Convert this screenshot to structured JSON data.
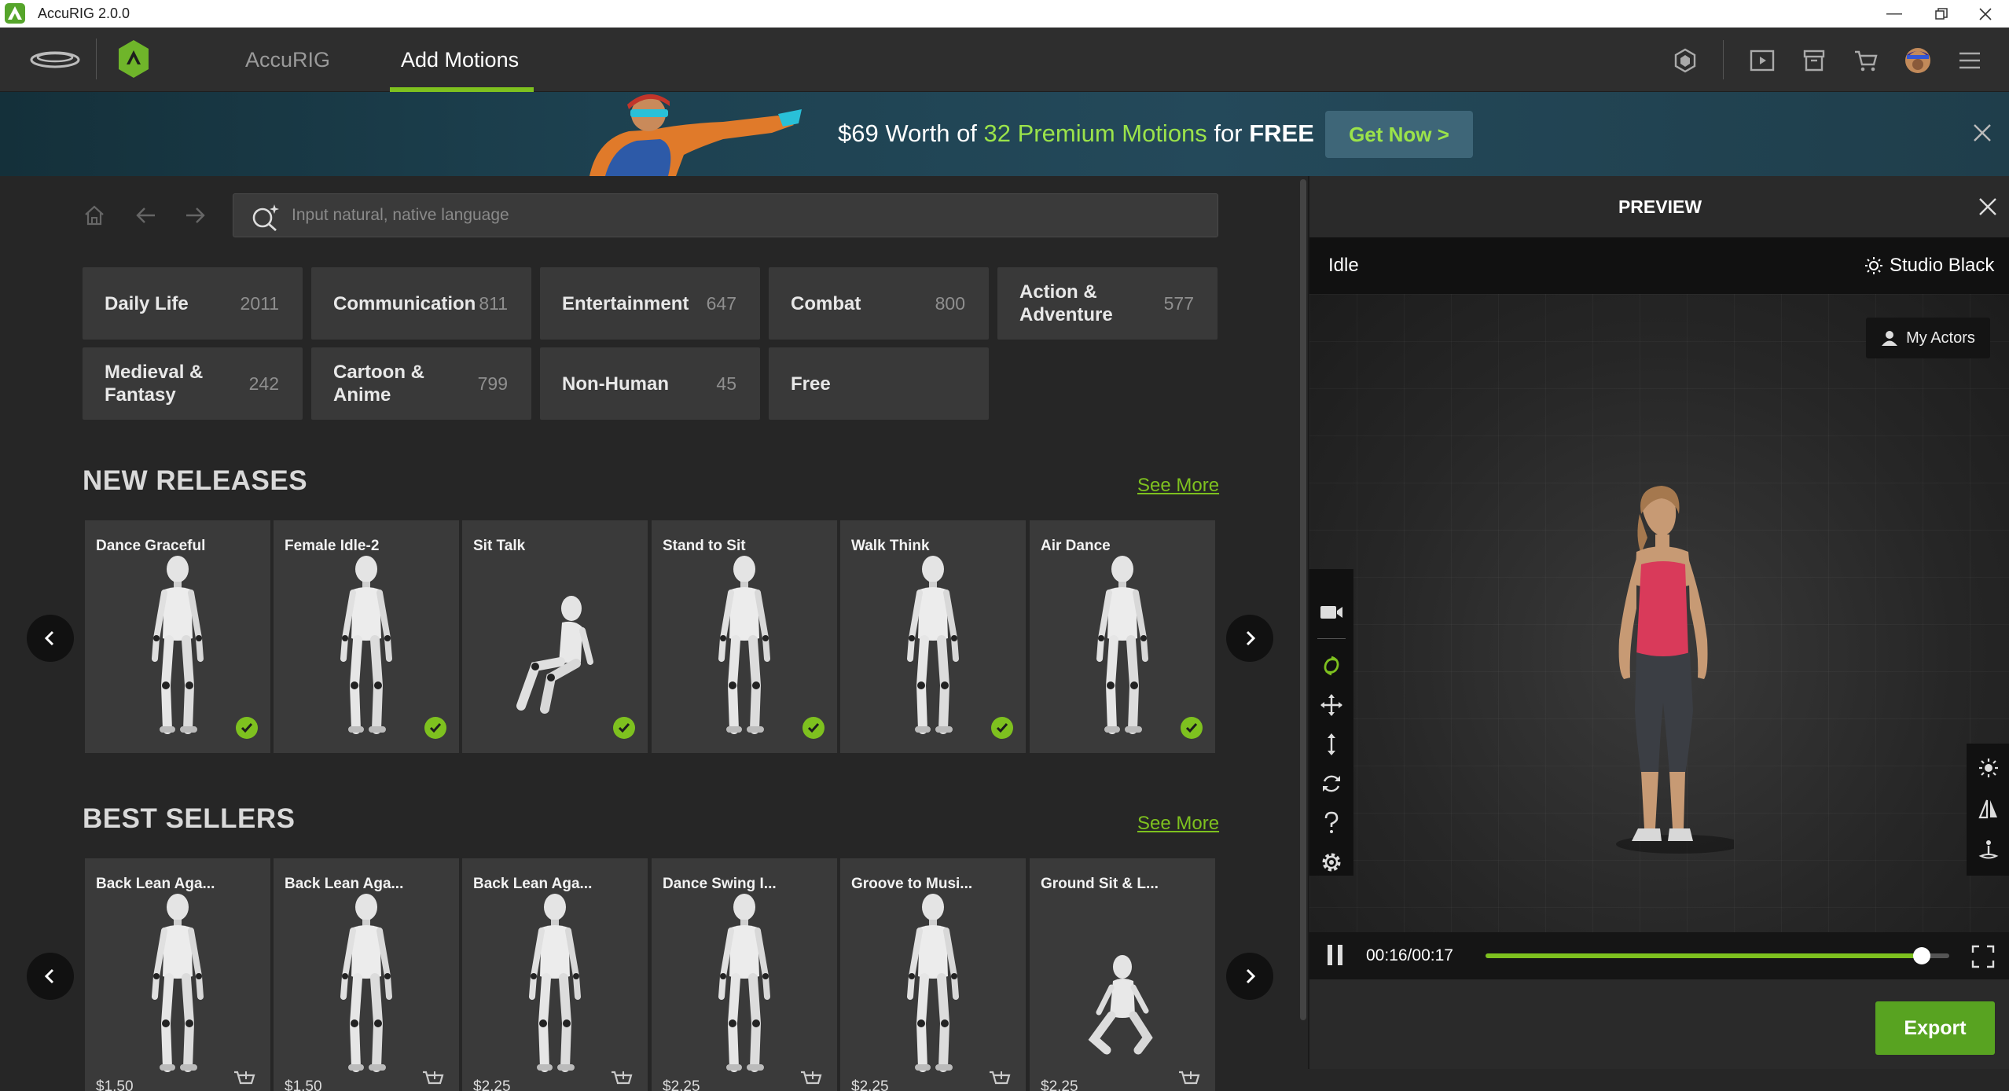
{
  "window": {
    "title": "AccuRIG 2.0.0"
  },
  "nav": {
    "tabs": [
      {
        "label": "AccuRIG",
        "active": false
      },
      {
        "label": "Add Motions",
        "active": true
      }
    ]
  },
  "banner": {
    "text_price": "$69 Worth of ",
    "text_highlight": "32 Premium Motions",
    "text_for": " for ",
    "text_free": "FREE",
    "cta": "Get Now >"
  },
  "search": {
    "placeholder": "Input natural, native language",
    "value": ""
  },
  "categories": [
    {
      "name": "Daily Life",
      "count": "2011"
    },
    {
      "name": "Communication",
      "count": "811"
    },
    {
      "name": "Entertainment",
      "count": "647"
    },
    {
      "name": "Combat",
      "count": "800"
    },
    {
      "name": "Action & Adventure",
      "count": "577"
    },
    {
      "name": "Medieval & Fantasy",
      "count": "242"
    },
    {
      "name": "Cartoon & Anime",
      "count": "799"
    },
    {
      "name": "Non-Human",
      "count": "45"
    },
    {
      "name": "Free",
      "count": ""
    }
  ],
  "new_releases": {
    "title": "NEW RELEASES",
    "see_more": "See More",
    "items": [
      {
        "title": "Dance Graceful",
        "owned": true
      },
      {
        "title": "Female Idle-2",
        "owned": true
      },
      {
        "title": "Sit Talk",
        "owned": true
      },
      {
        "title": "Stand to Sit",
        "owned": true
      },
      {
        "title": "Walk Think",
        "owned": true
      },
      {
        "title": "Air Dance",
        "owned": true
      }
    ]
  },
  "best_sellers": {
    "title": "BEST SELLERS",
    "see_more": "See More",
    "items": [
      {
        "title": "Back Lean Aga...",
        "price": "$1.50"
      },
      {
        "title": "Back Lean Aga...",
        "price": "$1.50"
      },
      {
        "title": "Back Lean Aga...",
        "price": "$2.25"
      },
      {
        "title": "Dance Swing I...",
        "price": "$2.25"
      },
      {
        "title": "Groove to Musi...",
        "price": "$2.25"
      },
      {
        "title": "Ground Sit & L...",
        "price": "$2.25"
      }
    ]
  },
  "preview": {
    "title": "PREVIEW",
    "motion_name": "Idle",
    "environment": "Studio Black",
    "my_actors": "My Actors",
    "time": "00:16/00:17",
    "progress": 0.94,
    "export": "Export"
  },
  "colors": {
    "accent": "#7ec11f",
    "banner_highlight": "#9be34a",
    "export": "#58a321"
  }
}
